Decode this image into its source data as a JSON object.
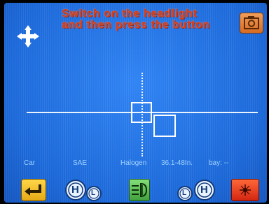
{
  "instruction": {
    "line1": "Switch on the headlight",
    "line2": "and then press the button"
  },
  "status": {
    "vehicle": "Car",
    "standard": "SAE",
    "lamp_type": "Halogen",
    "height_range": "36.1-48In.",
    "bay": "bay: --"
  },
  "icons": {
    "dpad": "move-arrows-icon",
    "camera": "camera-icon",
    "enter": "enter-arrow-icon",
    "high_low": "high-low-beam-icon",
    "fog": "fog-light-icon",
    "low_high": "low-high-beam-icon",
    "laser": "laser-icon"
  },
  "bottom_buttons": {
    "high_low_left": "H",
    "high_low_right": "L",
    "low_high_left": "L",
    "low_high_right": "H"
  },
  "colors": {
    "screen_blue": "#1e6fe0",
    "instruction_red": "#d33b1a",
    "status_text": "#9fd2ff",
    "enter_yellow": "#ffd84a",
    "fog_green": "#5fbf55",
    "laser_red": "#e53a1a",
    "camera_orange": "#e98a3c"
  }
}
